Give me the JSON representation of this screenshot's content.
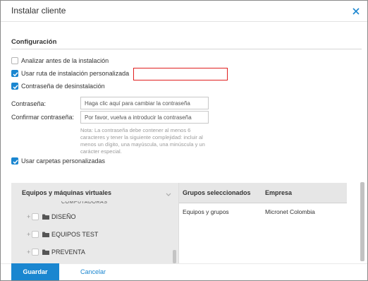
{
  "dialog": {
    "title": "Instalar cliente",
    "close_icon": "close-icon",
    "accent_color": "#1a86d0"
  },
  "config": {
    "section_title": "Configuración",
    "options": [
      {
        "label": "Analizar antes de la instalación",
        "checked": false
      },
      {
        "label": "Usar ruta de instalación personalizada",
        "checked": true
      },
      {
        "label": "Contraseña de desinstalación",
        "checked": true
      }
    ],
    "custom_path_value": "",
    "password_label": "Contraseña:",
    "password_placeholder": "Haga clic aquí para cambiar la contraseña",
    "confirm_label": "Confirmar contraseña:",
    "confirm_placeholder": "Por favor, vuelva a introducir la contraseña",
    "note": "Nota: La contraseña debe contener al menos 6 caracteres y tener la siguiente complejidad: incluir al menos un dígito, una mayúscula, una minúscula y un carácter especial.",
    "custom_folders": {
      "label": "Usar carpetas personalizadas",
      "checked": true
    }
  },
  "tree": {
    "title": "Equipos y máquinas virtuales",
    "partial_item": "COMPUTADORAS",
    "items": [
      {
        "label": "DISEÑO",
        "icon": "folder-icon"
      },
      {
        "label": "EQUIPOS TEST",
        "icon": "folder-icon"
      },
      {
        "label": "PREVENTA",
        "icon": "folder-icon"
      }
    ]
  },
  "selected": {
    "columns": [
      "Grupos seleccionados",
      "Empresa"
    ],
    "rows": [
      {
        "group": "Equipos y grupos",
        "company": "Micronet Colombia"
      }
    ]
  },
  "footer": {
    "save_label": "Guardar",
    "cancel_label": "Cancelar"
  }
}
